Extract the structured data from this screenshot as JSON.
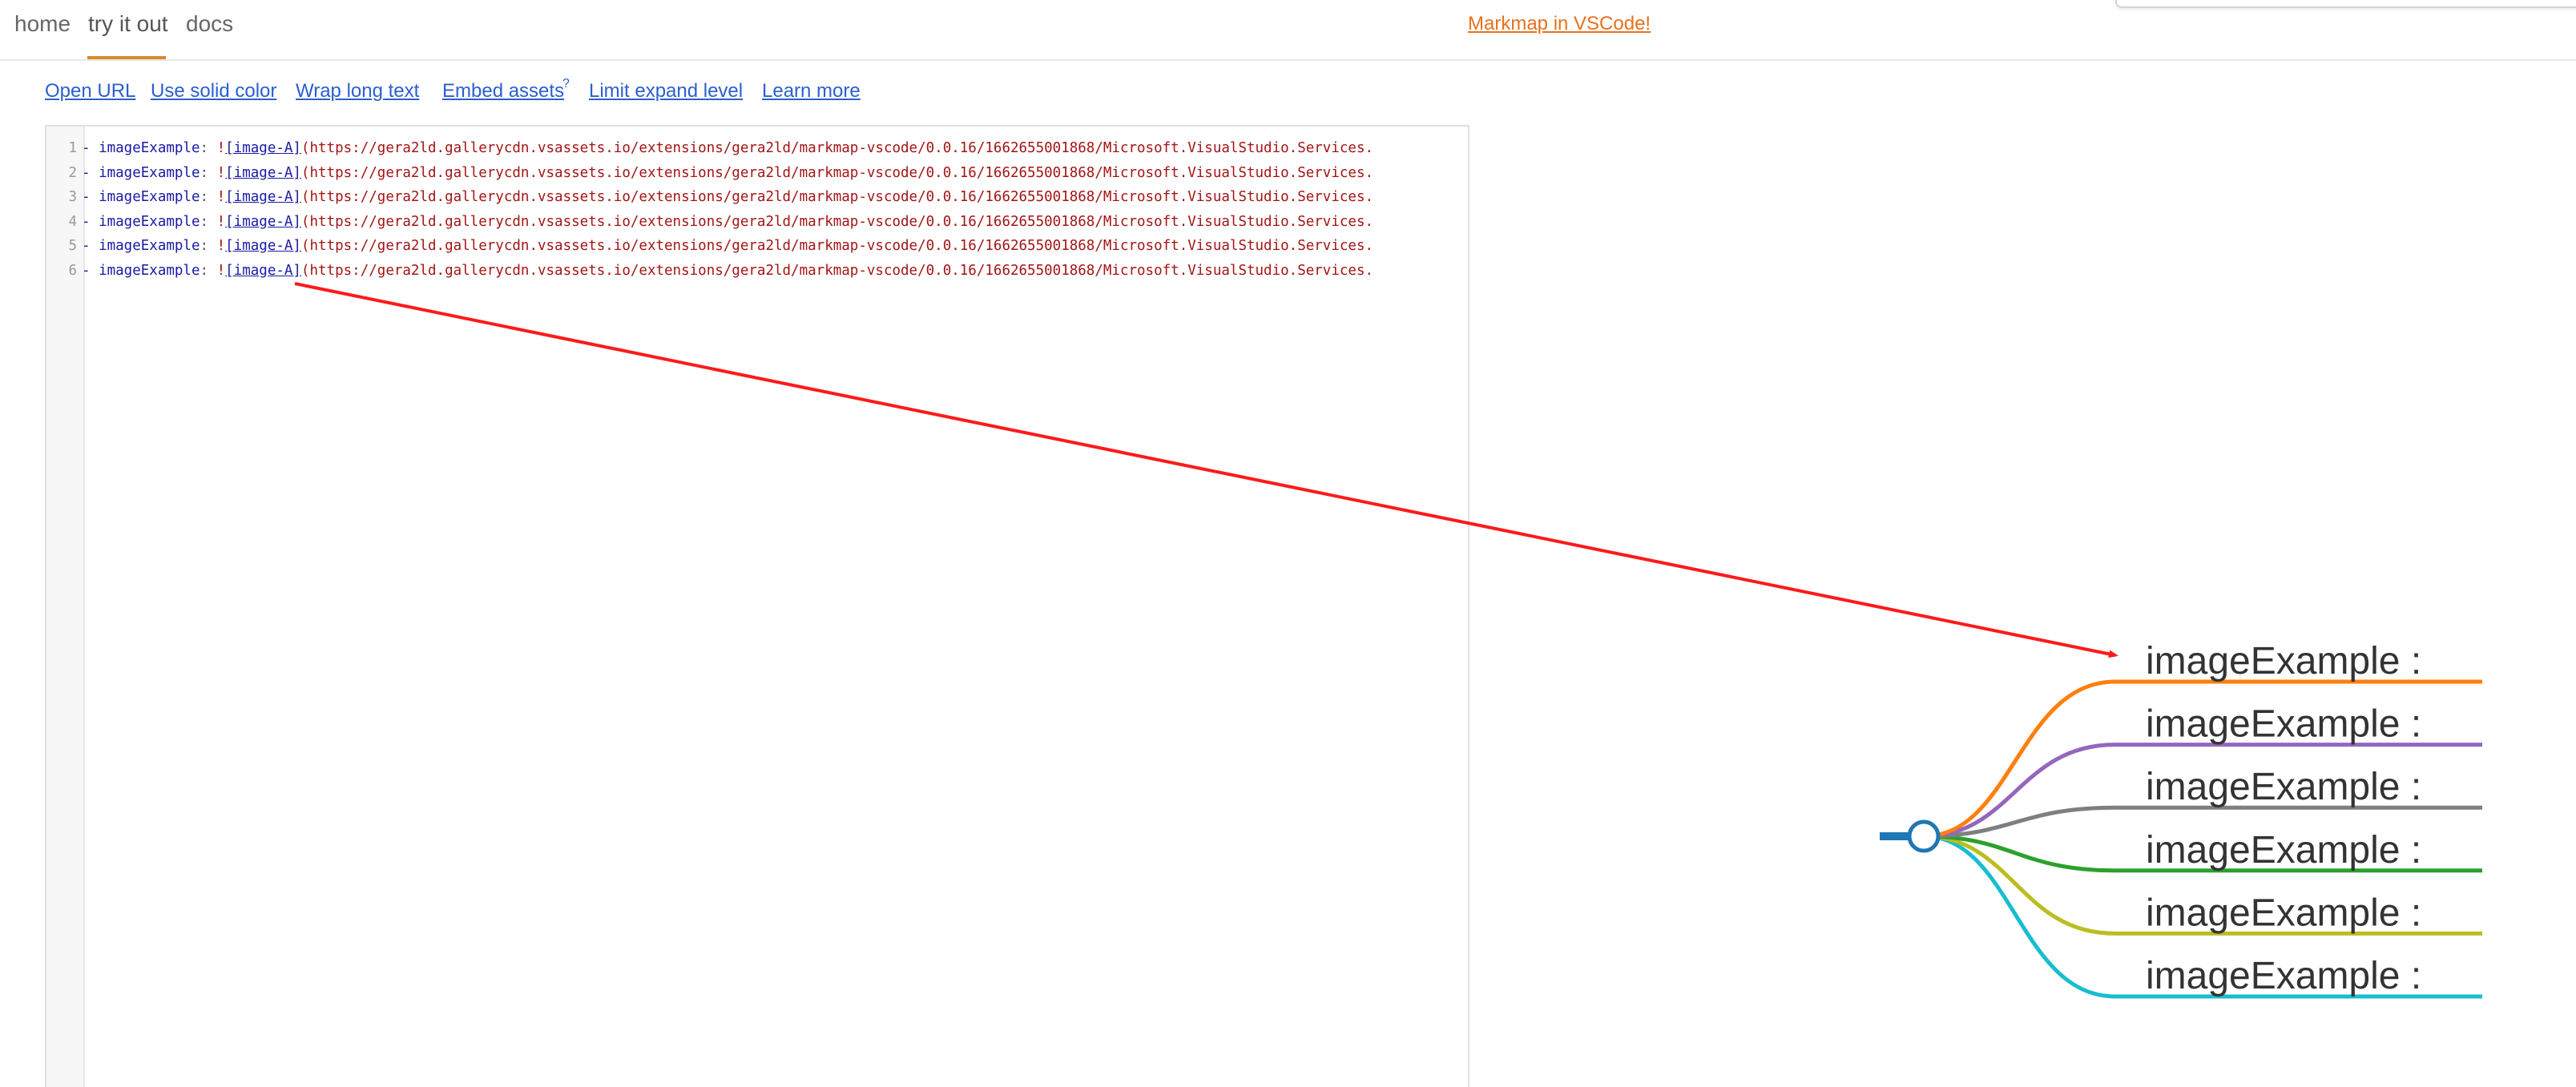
{
  "nav": {
    "tabs": [
      {
        "label": "home"
      },
      {
        "label": "try it out",
        "active": true
      },
      {
        "label": "docs"
      }
    ],
    "promo_link": "Markmap in VSCode!"
  },
  "toolbar": {
    "links": [
      {
        "label": "Open URL"
      },
      {
        "label": "Use solid color"
      },
      {
        "label": "Wrap long text"
      },
      {
        "label": "Embed assets",
        "sup": "?"
      },
      {
        "label": "Limit expand level"
      },
      {
        "label": "Learn more"
      }
    ]
  },
  "editor": {
    "lines": [
      {
        "num": "1",
        "dash": "- ",
        "key": "imageExample",
        "colon": ": ",
        "bang": "!",
        "link": "[image-A]",
        "url": "(https://gera2ld.gallerycdn.vsassets.io/extensions/gera2ld/markmap-vscode/0.0.16/1662655001868/Microsoft.VisualStudio.Services."
      },
      {
        "num": "2",
        "dash": "- ",
        "key": "imageExample",
        "colon": ": ",
        "bang": "!",
        "link": "[image-A]",
        "url": "(https://gera2ld.gallerycdn.vsassets.io/extensions/gera2ld/markmap-vscode/0.0.16/1662655001868/Microsoft.VisualStudio.Services."
      },
      {
        "num": "3",
        "dash": "- ",
        "key": "imageExample",
        "colon": ": ",
        "bang": "!",
        "link": "[image-A]",
        "url": "(https://gera2ld.gallerycdn.vsassets.io/extensions/gera2ld/markmap-vscode/0.0.16/1662655001868/Microsoft.VisualStudio.Services."
      },
      {
        "num": "4",
        "dash": "- ",
        "key": "imageExample",
        "colon": ": ",
        "bang": "!",
        "link": "[image-A]",
        "url": "(https://gera2ld.gallerycdn.vsassets.io/extensions/gera2ld/markmap-vscode/0.0.16/1662655001868/Microsoft.VisualStudio.Services."
      },
      {
        "num": "5",
        "dash": "- ",
        "key": "imageExample",
        "colon": ": ",
        "bang": "!",
        "link": "[image-A]",
        "url": "(https://gera2ld.gallerycdn.vsassets.io/extensions/gera2ld/markmap-vscode/0.0.16/1662655001868/Microsoft.VisualStudio.Services."
      },
      {
        "num": "6",
        "dash": "- ",
        "key": "imageExample",
        "colon": ": ",
        "bang": "!",
        "link": "[image-A]",
        "url": "(https://gera2ld.gallerycdn.vsassets.io/extensions/gera2ld/markmap-vscode/0.0.16/1662655001868/Microsoft.VisualStudio.Services."
      }
    ]
  },
  "markmap": {
    "root_color": "#1f77b4",
    "annotation_color": "#ff1a1a",
    "branches": [
      {
        "label": "imageExample :",
        "color": "#ff7f0e"
      },
      {
        "label": "imageExample :",
        "color": "#9467bd"
      },
      {
        "label": "imageExample :",
        "color": "#7f7f7f"
      },
      {
        "label": "imageExample :",
        "color": "#2ca02c"
      },
      {
        "label": "imageExample :",
        "color": "#bcbd22"
      },
      {
        "label": "imageExample :",
        "color": "#17becf"
      }
    ]
  }
}
